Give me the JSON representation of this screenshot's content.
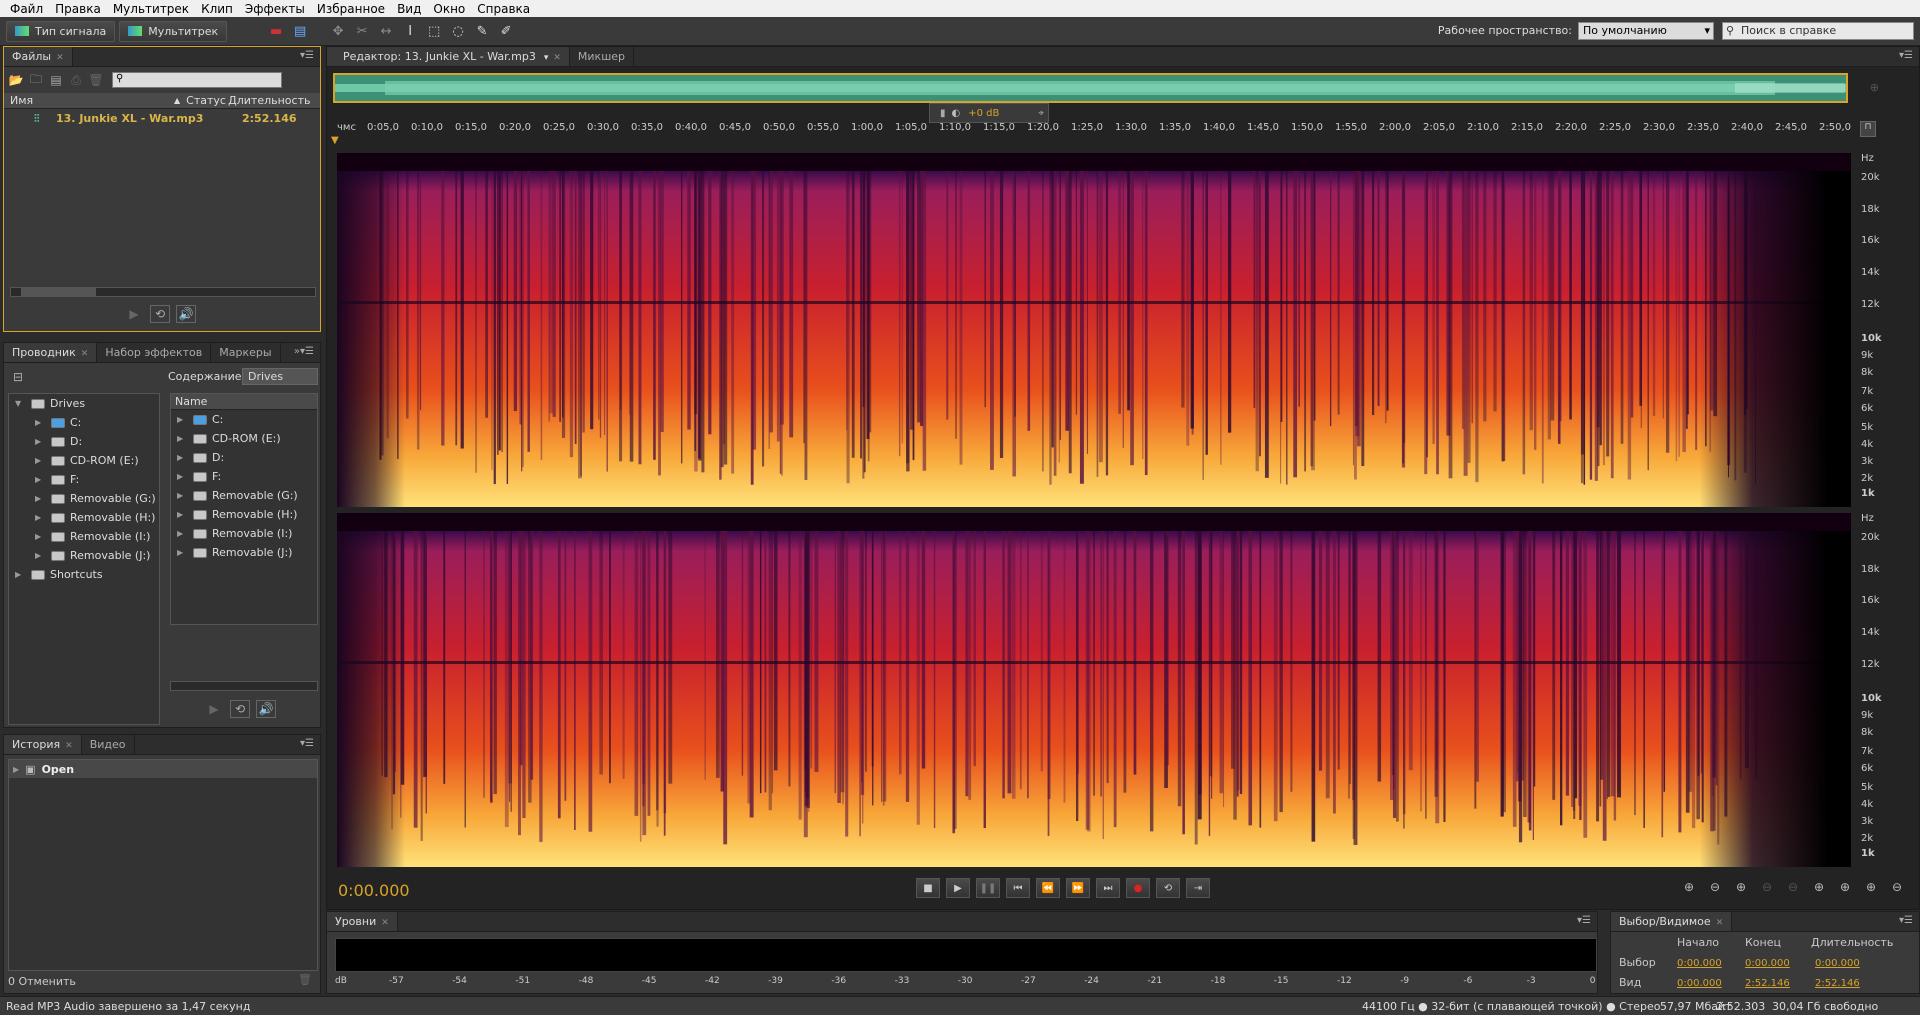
{
  "menu": [
    "Файл",
    "Правка",
    "Мультитрек",
    "Клип",
    "Эффекты",
    "Избранное",
    "Вид",
    "Окно",
    "Справка"
  ],
  "toolbar": {
    "waveform_label": "Тип сигнала",
    "multitrack_label": "Мультитрек",
    "workspace_label": "Рабочее пространство:",
    "workspace_value": "По умолчанию",
    "search_placeholder": "Поиск в справке"
  },
  "files_panel": {
    "tab": "Файлы",
    "columns": {
      "name": "Имя",
      "status": "Статус",
      "duration": "Длительность"
    },
    "files": [
      {
        "name": "13. Junkie XL - War.mp3",
        "duration": "2:52.146"
      }
    ]
  },
  "explorer_panel": {
    "tabs": [
      "Проводник",
      "Набор эффектов",
      "Маркеры"
    ],
    "content_label": "Содержание:",
    "content_value": "Drives",
    "name_col": "Name",
    "tree_root": "Drives",
    "tree_items": [
      "C:",
      "D:",
      "CD-ROM (E:)",
      "F:",
      "Removable (G:)",
      "Removable (H:)",
      "Removable (I:)",
      "Removable (J:)"
    ],
    "tree_shortcuts": "Shortcuts",
    "list_items": [
      "C:",
      "CD-ROM (E:)",
      "D:",
      "F:",
      "Removable (G:)",
      "Removable (H:)",
      "Removable (I:)",
      "Removable (J:)"
    ]
  },
  "history_panel": {
    "tabs": [
      "История",
      "Видео"
    ],
    "items": [
      "Open"
    ],
    "undo_status": "0 Отменить"
  },
  "editor": {
    "tab": "Редактор: 13. Junkie XL - War.mp3",
    "mixer_tab": "Микшер",
    "gain": "+0 dB",
    "timecode": "0:00.000",
    "ruler": [
      "чмс",
      "0:05,0",
      "0:10,0",
      "0:15,0",
      "0:20,0",
      "0:25,0",
      "0:30,0",
      "0:35,0",
      "0:40,0",
      "0:45,0",
      "0:50,0",
      "0:55,0",
      "1:00,0",
      "1:05,0",
      "1:10,0",
      "1:15,0",
      "1:20,0",
      "1:25,0",
      "1:30,0",
      "1:35,0",
      "1:40,0",
      "1:45,0",
      "1:50,0",
      "1:55,0",
      "2:00,0",
      "2:05,0",
      "2:10,0",
      "2:15,0",
      "2:20,0",
      "2:25,0",
      "2:30,0",
      "2:35,0",
      "2:40,0",
      "2:45,0",
      "2:50,0"
    ],
    "hz_labels": [
      "Hz",
      "20k",
      "18k",
      "16k",
      "14k",
      "12k",
      "10k",
      "9k",
      "8k",
      "7k",
      "6k",
      "5k",
      "4k",
      "3k",
      "2k",
      "1k"
    ]
  },
  "levels_panel": {
    "tab": "Уровни",
    "scale": [
      "dB",
      "-57",
      "-54",
      "-51",
      "-48",
      "-45",
      "-42",
      "-39",
      "-36",
      "-33",
      "-30",
      "-27",
      "-24",
      "-21",
      "-18",
      "-15",
      "-12",
      "-9",
      "-6",
      "-3",
      "0"
    ]
  },
  "selection_panel": {
    "tab": "Выбор/Видимое",
    "headers": [
      "Начало",
      "Конец",
      "Длительность"
    ],
    "rows": [
      {
        "label": "Выбор",
        "start": "0:00.000",
        "end": "0:00.000",
        "duration": "0:00.000"
      },
      {
        "label": "Вид",
        "start": "0:00.000",
        "end": "2:52.146",
        "duration": "2:52.146"
      }
    ]
  },
  "status": {
    "left": "Read MP3 Audio завершено за 1,47 секунд",
    "format": "44100 Гц ● 32-бит (с плавающей точкой) ● Стерео",
    "size": "57,97 Мбайт",
    "duration": "2:52.303",
    "free": "30,04 Гб свободно"
  }
}
